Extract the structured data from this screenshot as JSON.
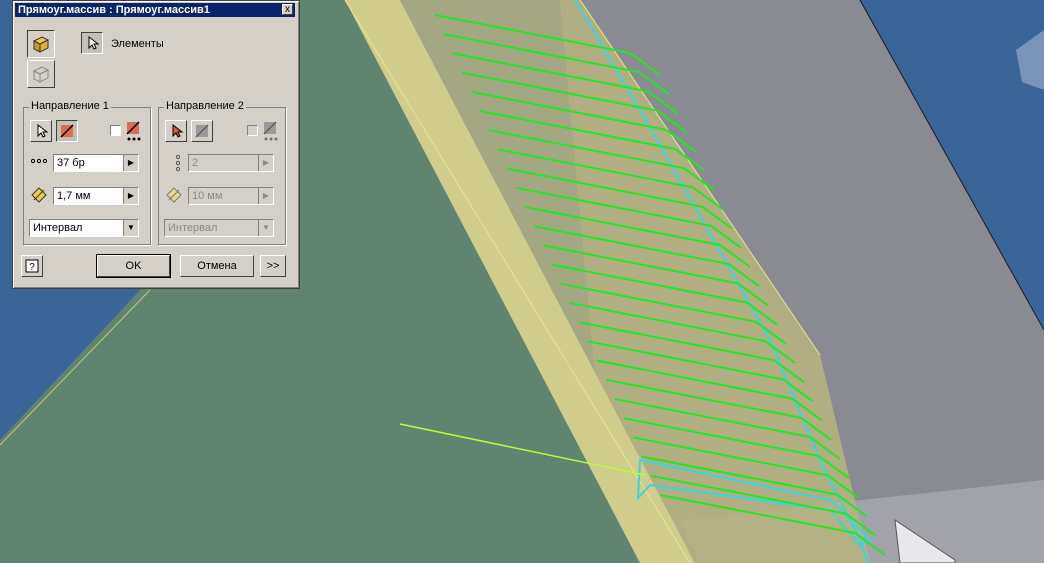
{
  "dialog": {
    "title": "Прямоуг.массив : Прямоуг.массив1",
    "close_label": "x",
    "elements_label": "Элементы",
    "direction1": {
      "legend": "Направление 1",
      "count_value": "37 бр",
      "spacing_value": "1,7 мм",
      "mode_value": "Интервал"
    },
    "direction2": {
      "legend": "Направление 2",
      "count_value": "2",
      "spacing_value": "10 мм",
      "mode_value": "Интервал"
    },
    "ok_label": "OK",
    "cancel_label": "Отмена",
    "more_label": ">>"
  },
  "icons": {
    "pattern_solids": "pattern-solids-icon",
    "pattern_features": "pattern-features-icon",
    "elements_select": "cursor-icon",
    "help": "help-icon"
  },
  "colors": {
    "viewport_background": "#3a6598",
    "green_part_face": "#5f8470",
    "gray_part_face": "#8a8a92",
    "highlight_face": "#cfcc8c",
    "pattern_preview": "#22e622",
    "selection_edge": "#36d6e0",
    "title_bar": "#0a246a",
    "dialog_face": "#d4d0c8"
  }
}
